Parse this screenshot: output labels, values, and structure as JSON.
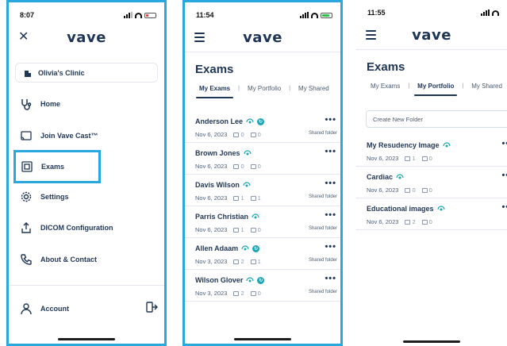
{
  "screen1": {
    "time": "8:07",
    "logo": "vave",
    "clinic": "Olivia's Clinic",
    "menu": [
      {
        "label": "Home",
        "icon": "stethoscope-icon"
      },
      {
        "label": "Join Vave Cast™",
        "icon": "cast-icon"
      },
      {
        "label": "Exams",
        "icon": "exams-icon",
        "active": true
      },
      {
        "label": "Settings",
        "icon": "gear-icon"
      },
      {
        "label": "DICOM Configuration",
        "icon": "upload-icon"
      },
      {
        "label": "About & Contact",
        "icon": "phone-icon"
      }
    ],
    "account": "Account"
  },
  "screen2": {
    "time": "11:54",
    "logo": "vave",
    "title": "Exams",
    "tabs": [
      "My Exams",
      "My Portfolio",
      "My Shared"
    ],
    "active_tab": "My Exams",
    "exams": [
      {
        "name": "Anderson Lee",
        "badge": true,
        "date": "Nov 6, 2023",
        "images": "0",
        "videos": "0",
        "shared": "Shared folder"
      },
      {
        "name": "Brown Jones",
        "badge": false,
        "date": "Nov 6, 2023",
        "images": "0",
        "videos": "0",
        "shared": ""
      },
      {
        "name": "Davis Wilson",
        "badge": false,
        "date": "Nov 6, 2023",
        "images": "1",
        "videos": "1",
        "shared": "Shared folder"
      },
      {
        "name": "Parris Christian",
        "badge": false,
        "date": "Nov 6, 2023",
        "images": "1",
        "videos": "0",
        "shared": "Shared folder"
      },
      {
        "name": "Allen Adaam",
        "badge": true,
        "date": "Nov 3, 2023",
        "images": "2",
        "videos": "1",
        "shared": "Shared folder"
      },
      {
        "name": "Wilson Glover",
        "badge": true,
        "date": "Nov 3, 2023",
        "images": "2",
        "videos": "0",
        "shared": "Shared folder"
      }
    ]
  },
  "screen3": {
    "time": "11:55",
    "logo": "vave",
    "title": "Exams",
    "tabs": [
      "My Exams",
      "My Portfolio",
      "My Shared"
    ],
    "active_tab": "My Portfolio",
    "new_folder": "Create New Folder",
    "folders": [
      {
        "name": "My Resudency Image",
        "date": "Nov 6, 2023",
        "images": "1",
        "videos": "0"
      },
      {
        "name": "Cardiac",
        "date": "Nov 6, 2023",
        "images": "0",
        "videos": "0"
      },
      {
        "name": "Educational images",
        "date": "Nov 6, 2023",
        "images": "2",
        "videos": "0"
      }
    ]
  },
  "colors": {
    "accent": "#29a8e0",
    "brand": "#1f3556",
    "badge": "#1aa6b7"
  }
}
